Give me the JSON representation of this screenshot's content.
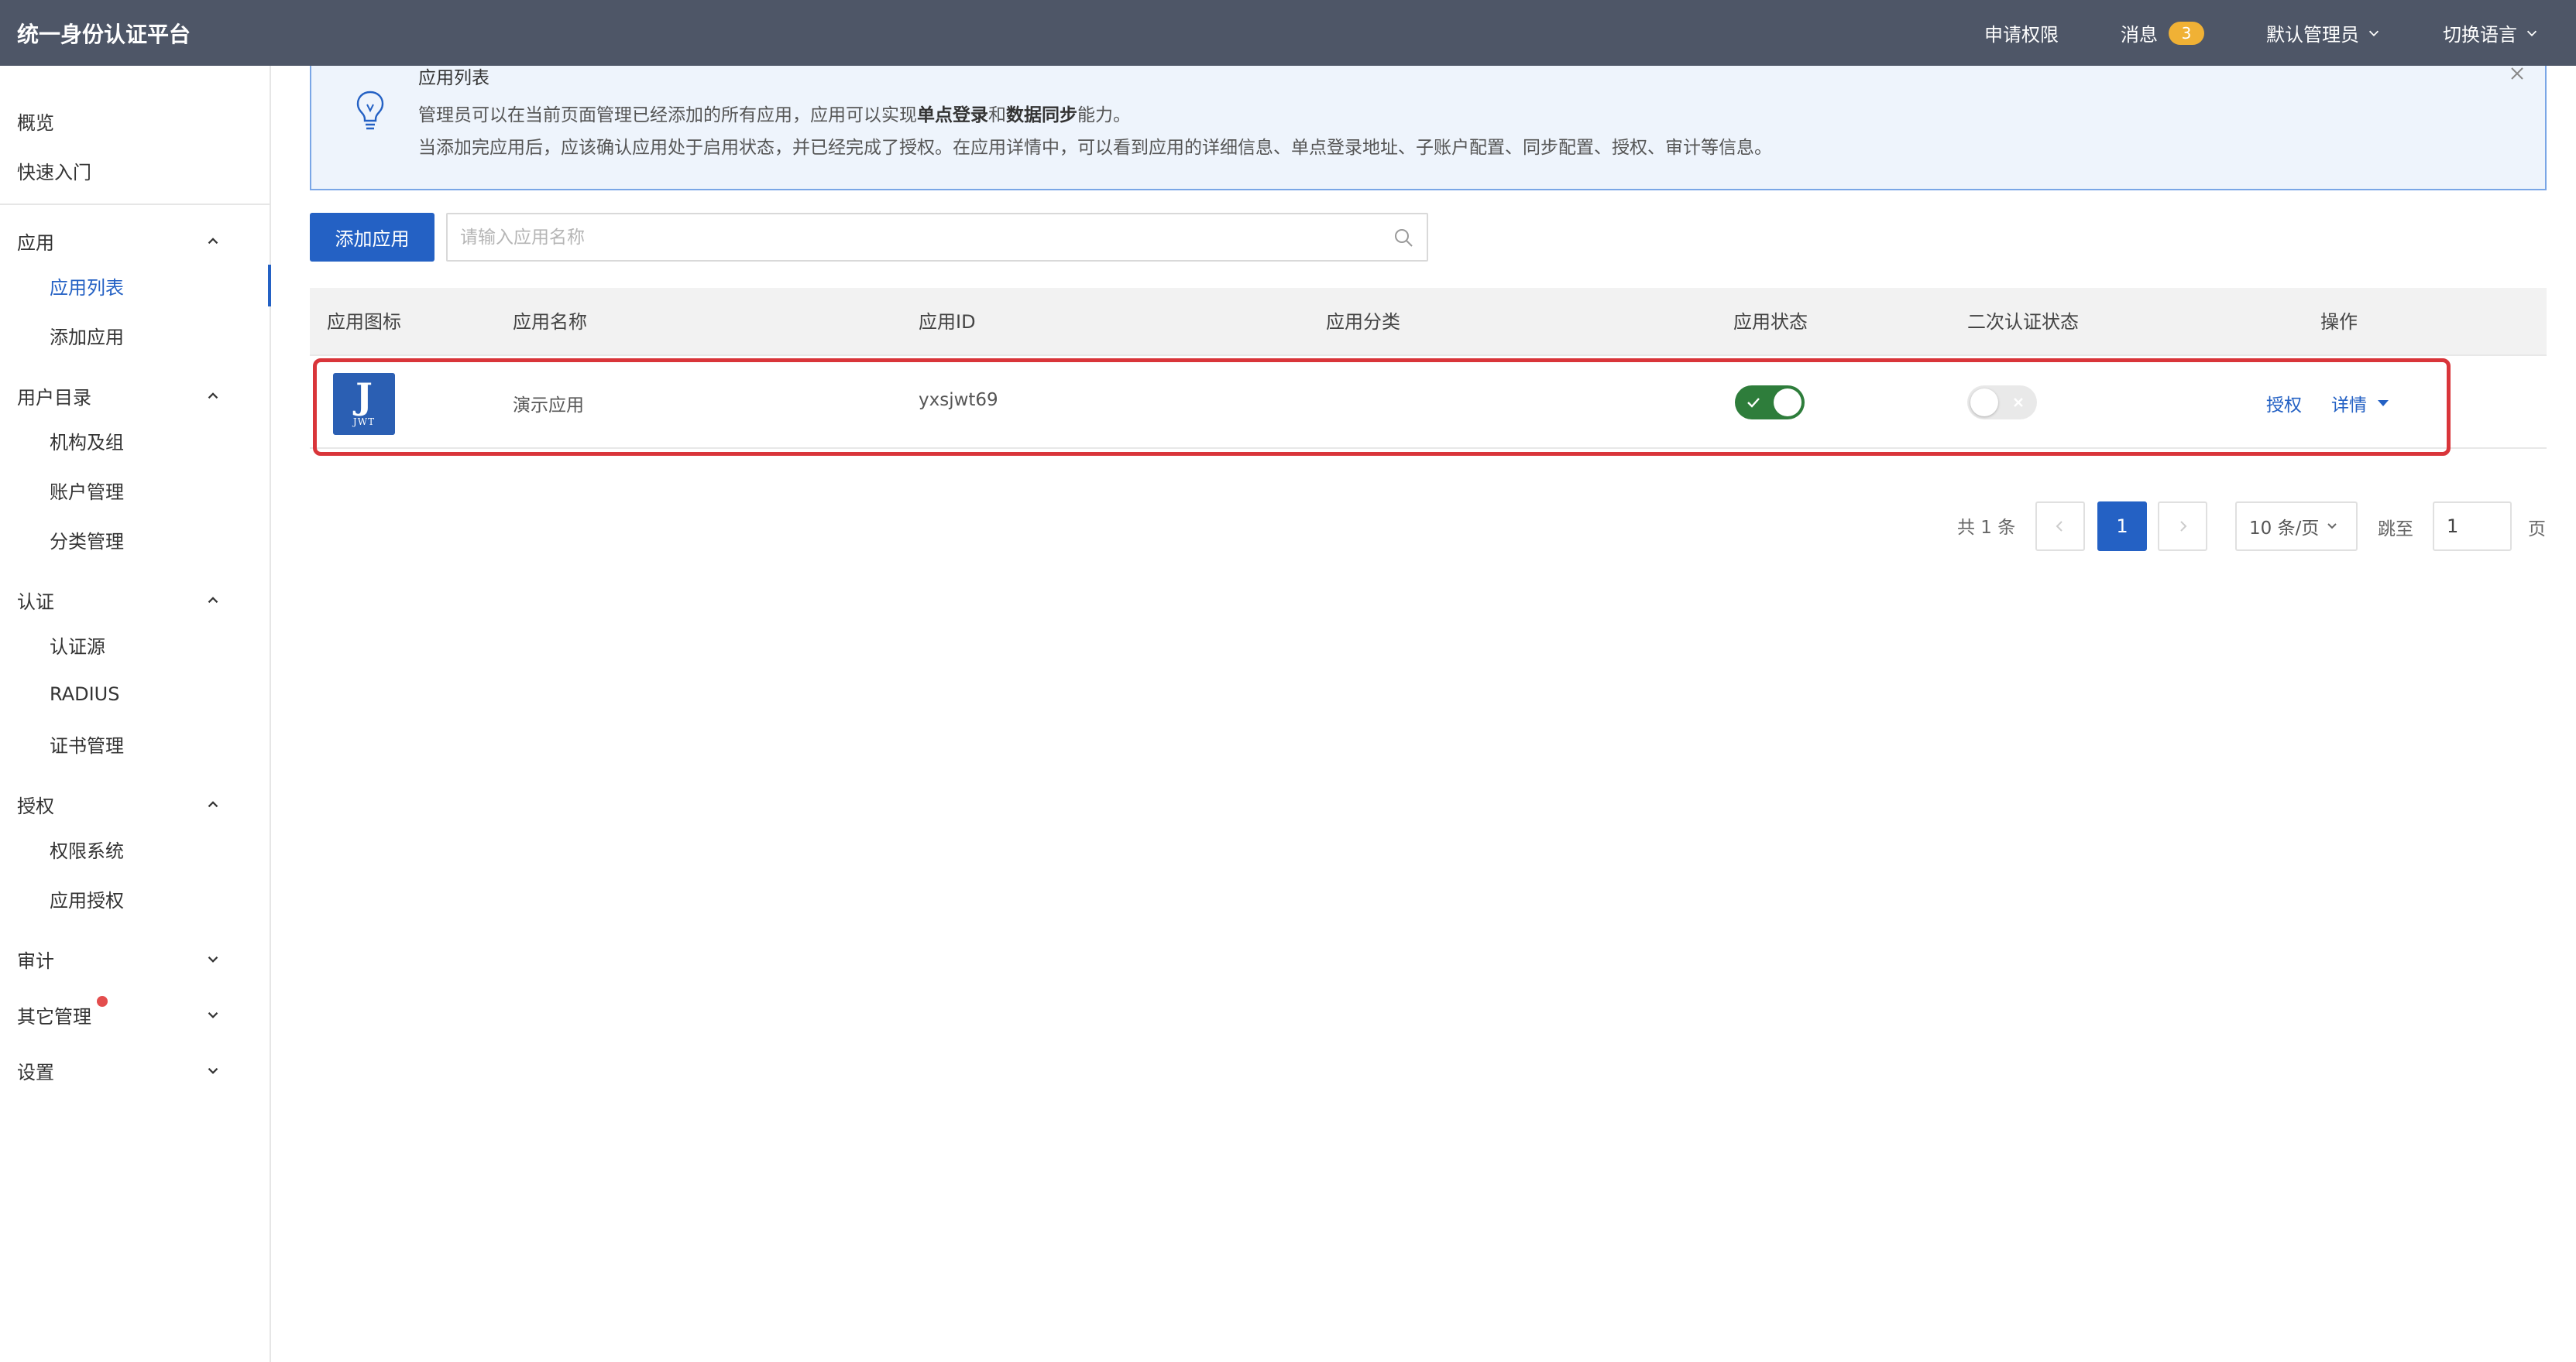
{
  "header": {
    "brand": "统一身份认证平台",
    "apply_permission": "申请权限",
    "messages_label": "消息",
    "messages_count": "3",
    "admin_label": "默认管理员",
    "language_label": "切换语言"
  },
  "sidebar": {
    "overview": "概览",
    "quickstart": "快速入门",
    "groups": [
      {
        "label": "应用",
        "expanded": true,
        "items": [
          "应用列表",
          "添加应用"
        ]
      },
      {
        "label": "用户目录",
        "expanded": true,
        "items": [
          "机构及组",
          "账户管理",
          "分类管理"
        ]
      },
      {
        "label": "认证",
        "expanded": true,
        "items": [
          "认证源",
          "RADIUS",
          "证书管理"
        ]
      },
      {
        "label": "授权",
        "expanded": true,
        "items": [
          "权限系统",
          "应用授权"
        ]
      },
      {
        "label": "审计",
        "expanded": false,
        "items": []
      },
      {
        "label": "其它管理",
        "expanded": false,
        "items": [],
        "dot": true
      },
      {
        "label": "设置",
        "expanded": false,
        "items": []
      }
    ],
    "active_item": "应用列表"
  },
  "notice": {
    "title": "应用列表",
    "line1_pre": "管理员可以在当前页面管理已经添加的所有应用，应用可以实现",
    "line1_bold1": "单点登录",
    "line1_mid": "和",
    "line1_bold2": "数据同步",
    "line1_post": "能力。",
    "line2": "当添加完应用后，应该确认应用处于启用状态，并已经完成了授权。在应用详情中，可以看到应用的详细信息、单点登录地址、子账户配置、同步配置、授权、审计等信息。"
  },
  "toolbar": {
    "add_button": "添加应用",
    "search_placeholder": "请输入应用名称"
  },
  "table": {
    "columns": [
      "应用图标",
      "应用名称",
      "应用ID",
      "应用分类",
      "应用状态",
      "二次认证状态",
      "操作"
    ],
    "rows": [
      {
        "logo_big": "J",
        "logo_small": "JWT",
        "name": "演示应用",
        "app_id": "yxsjwt69",
        "category": "",
        "status_enabled": true,
        "mfa_enabled": false,
        "action_authorize": "授权",
        "action_detail": "详情"
      }
    ]
  },
  "pagination": {
    "total": "共 1 条",
    "current_page": "1",
    "page_size": "10 条/页",
    "jump_label": "跳至",
    "jump_value": "1",
    "page_unit": "页"
  },
  "colors": {
    "header_bg": "#4e5667",
    "primary": "#2461c4",
    "switch_on": "#2e7d3b",
    "highlight": "#d9353a",
    "badge": "#f0b135"
  }
}
